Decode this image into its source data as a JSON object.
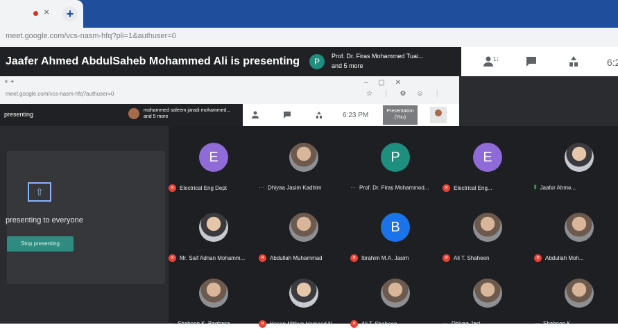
{
  "browser": {
    "url": "meet.google.com/vcs-nasm-hfq?pli=1&authuser=0"
  },
  "meet": {
    "presenting_title": "Jaafer Ahmed AbdulSaheb Mohammed Ali is presenting",
    "presenter_avatar_letter": "P",
    "presentation_owner": "Prof. Dr. Firas Mohammed Tuai...",
    "presentation_owner_more": "and 5 more",
    "time": "6:2"
  },
  "nested": {
    "tab_label": "×  +",
    "url": "meet.google.com/vcs-nasm-hfq?authuser=0",
    "window_controls": "–  ▢  ✕",
    "toolbar_icons": "☆ ⋮ ⚙ ☺ ⋮",
    "title": "presenting",
    "presenter": "mohammed saleem jaradi mohammed...",
    "presenter_more": "and 5 more",
    "time": "6:23 PM",
    "present_button": "Presentation (You)"
  },
  "left_panel": {
    "present_icon": "⇧",
    "text": "presenting to everyone",
    "stop_button": "Stop presenting"
  },
  "colors": {
    "teal_avatar": "#1e8e7e",
    "purple_avatar": "#8e6bd6",
    "blue_avatar": "#1a73e8",
    "mic_off": "#ea4335"
  },
  "participants": [
    {
      "name": "Electrical Eng Dept",
      "letter": "E",
      "avatar": "letter",
      "color": "#8e6bd6",
      "status": "muted"
    },
    {
      "name": "Dhiyaa Jasim Kadhim",
      "letter": "",
      "avatar": "photo",
      "color": "",
      "status": "idle"
    },
    {
      "name": "Prof. Dr. Firas Mohammed...",
      "letter": "P",
      "avatar": "letter",
      "color": "#1e8e7e",
      "status": "idle"
    },
    {
      "name": "Electrical Eng...",
      "letter": "E",
      "avatar": "letter",
      "color": "#8e6bd6",
      "status": "muted"
    },
    {
      "name": "Jaafer Ahme...",
      "letter": "",
      "avatar": "photo2",
      "color": "",
      "status": "speaking"
    },
    {
      "name": "Mr. Saif Adnan Mohamm...",
      "letter": "",
      "avatar": "photo2",
      "color": "",
      "status": "muted"
    },
    {
      "name": "Abdullah Muhammad",
      "letter": "",
      "avatar": "photo",
      "color": "",
      "status": "muted"
    },
    {
      "name": "Ibrahim M.A. Jasim",
      "letter": "B",
      "avatar": "letter",
      "color": "#1a73e8",
      "status": "muted"
    },
    {
      "name": "Ali T. Shaheen",
      "letter": "",
      "avatar": "photo",
      "color": "",
      "status": "muted"
    },
    {
      "name": "Abdullah Moh...",
      "letter": "",
      "avatar": "photo",
      "color": "",
      "status": "muted"
    },
    {
      "name": "Shaheen K. Baqhasa",
      "letter": "",
      "avatar": "photo",
      "color": "",
      "status": "idle"
    },
    {
      "name": "Hasan Mithun Hameed N...",
      "letter": "",
      "avatar": "photo2",
      "color": "",
      "status": "muted"
    },
    {
      "name": "Ali T. Shaheen",
      "letter": "",
      "avatar": "photo",
      "color": "",
      "status": "muted"
    },
    {
      "name": "Dhiyaa Jasi...",
      "letter": "",
      "avatar": "photo",
      "color": "",
      "status": "idle"
    },
    {
      "name": "Shaheen K...",
      "letter": "",
      "avatar": "photo",
      "color": "",
      "status": "idle"
    }
  ]
}
